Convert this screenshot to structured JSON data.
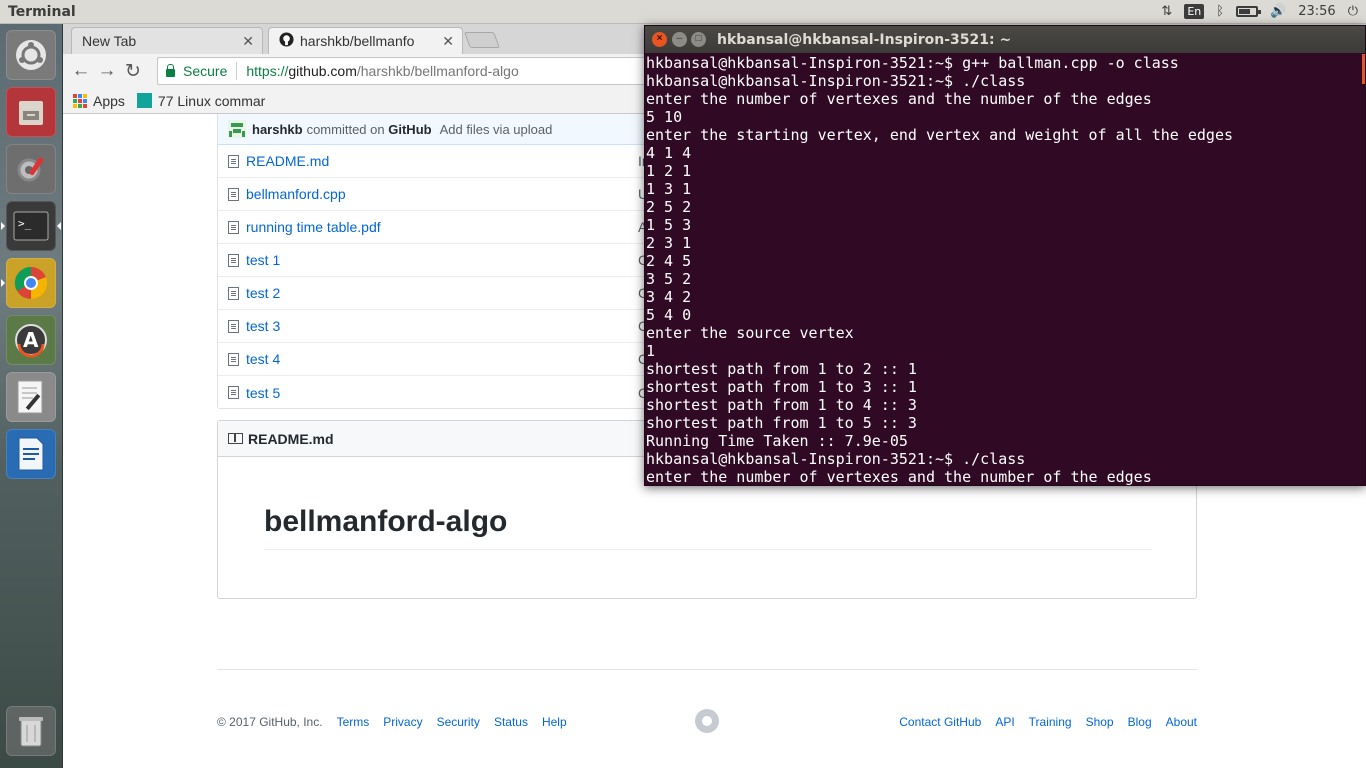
{
  "top_panel": {
    "title": "Terminal",
    "keyboard_layout": "En",
    "clock": "23:56"
  },
  "launcher": {
    "items": [
      {
        "name": "ubuntu-dash-icon"
      },
      {
        "name": "files-icon"
      },
      {
        "name": "system-settings-icon"
      },
      {
        "name": "terminal-icon"
      },
      {
        "name": "chrome-icon"
      },
      {
        "name": "software-updater-icon"
      },
      {
        "name": "text-editor-icon"
      },
      {
        "name": "libreoffice-writer-icon"
      },
      {
        "name": "trash-icon"
      }
    ]
  },
  "browser": {
    "tabs": [
      {
        "label": "New Tab",
        "active": false
      },
      {
        "label": "harshkb/bellmanfo",
        "active": true
      }
    ],
    "security_label": "Secure",
    "url": {
      "scheme": "https://",
      "host": "github.com",
      "path": "/harshkb/bellmanford-algo"
    },
    "bookmarks": [
      {
        "label": "Apps"
      },
      {
        "label": "77 Linux commar"
      }
    ]
  },
  "github": {
    "commit": {
      "author": "harshkb",
      "via": "committed on",
      "platform": "GitHub",
      "message": "Add files via upload"
    },
    "files": [
      {
        "name": "README.md",
        "msg": "In"
      },
      {
        "name": "bellmanford.cpp",
        "msg": "U"
      },
      {
        "name": "running time table.pdf",
        "msg": "A"
      },
      {
        "name": "test 1",
        "msg": "C"
      },
      {
        "name": "test 2",
        "msg": "C"
      },
      {
        "name": "test 3",
        "msg": "C"
      },
      {
        "name": "test 4",
        "msg": "C"
      },
      {
        "name": "test 5",
        "msg": "C"
      }
    ],
    "readme_header": "README.md",
    "readme_title": "bellmanford-algo",
    "footer": {
      "copyright": "© 2017 GitHub, Inc.",
      "left_links": [
        "Terms",
        "Privacy",
        "Security",
        "Status",
        "Help"
      ],
      "right_links": [
        "Contact GitHub",
        "API",
        "Training",
        "Shop",
        "Blog",
        "About"
      ]
    }
  },
  "terminal": {
    "title": "hkbansal@hkbansal-Inspiron-3521: ~",
    "lines": [
      "hkbansal@hkbansal-Inspiron-3521:~$ g++ ballman.cpp -o class",
      "hkbansal@hkbansal-Inspiron-3521:~$ ./class",
      "enter the number of vertexes and the number of the edges",
      "5 10",
      "enter the starting vertex, end vertex and weight of all the edges",
      "4 1 4",
      "1 2 1",
      "1 3 1",
      "2 5 2",
      "1 5 3",
      "2 3 1",
      "2 4 5",
      "3 5 2",
      "3 4 2",
      "5 4 0",
      "enter the source vertex",
      "1",
      "shortest path from 1 to 2 :: 1",
      "shortest path from 1 to 3 :: 1",
      "shortest path from 1 to 4 :: 3",
      "shortest path from 1 to 5 :: 3",
      "Running Time Taken :: 7.9e-05",
      "hkbansal@hkbansal-Inspiron-3521:~$ ./class",
      "enter the number of vertexes and the number of the edges"
    ]
  }
}
